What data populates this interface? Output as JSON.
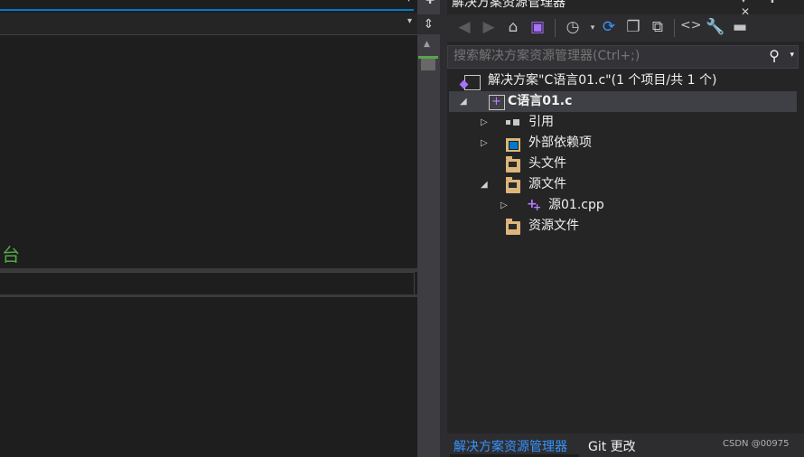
{
  "editor": {
    "partial_text": "台"
  },
  "solution_explorer": {
    "title": "解决方案资源管理器",
    "title_buttons": "▾ ✚ ✕",
    "search": {
      "placeholder": "搜索解决方案资源管理器(Ctrl+;)"
    },
    "tree": [
      {
        "label": "解决方案\"C语言01.c\"(1 个项目/共 1 个)",
        "icon": "solution-icon"
      },
      {
        "label": "C语言01.c",
        "icon": "cpp-project-icon",
        "expanded": true,
        "bold": true,
        "selected": true
      },
      {
        "label": "引用",
        "icon": "references-icon",
        "expanded": false
      },
      {
        "label": "外部依赖项",
        "icon": "external-dependencies-icon",
        "expanded": false
      },
      {
        "label": "头文件",
        "icon": "filter-folder-icon"
      },
      {
        "label": "源文件",
        "icon": "filter-folder-icon",
        "expanded": true
      },
      {
        "label": "源01.cpp",
        "icon": "cpp-file-icon",
        "expanded": false
      },
      {
        "label": "资源文件",
        "icon": "filter-folder-icon"
      }
    ],
    "tabs": [
      {
        "label": "解决方案资源管理器",
        "active": true
      },
      {
        "label": "Git 更改",
        "active": false
      }
    ]
  },
  "watermark": "CSDN @00975",
  "colors": {
    "accent": "#007acc",
    "active_tab_text": "#3794ff",
    "editor_green_text": "#57a64a",
    "background": "#1e1e1e",
    "panel": "#252526"
  }
}
